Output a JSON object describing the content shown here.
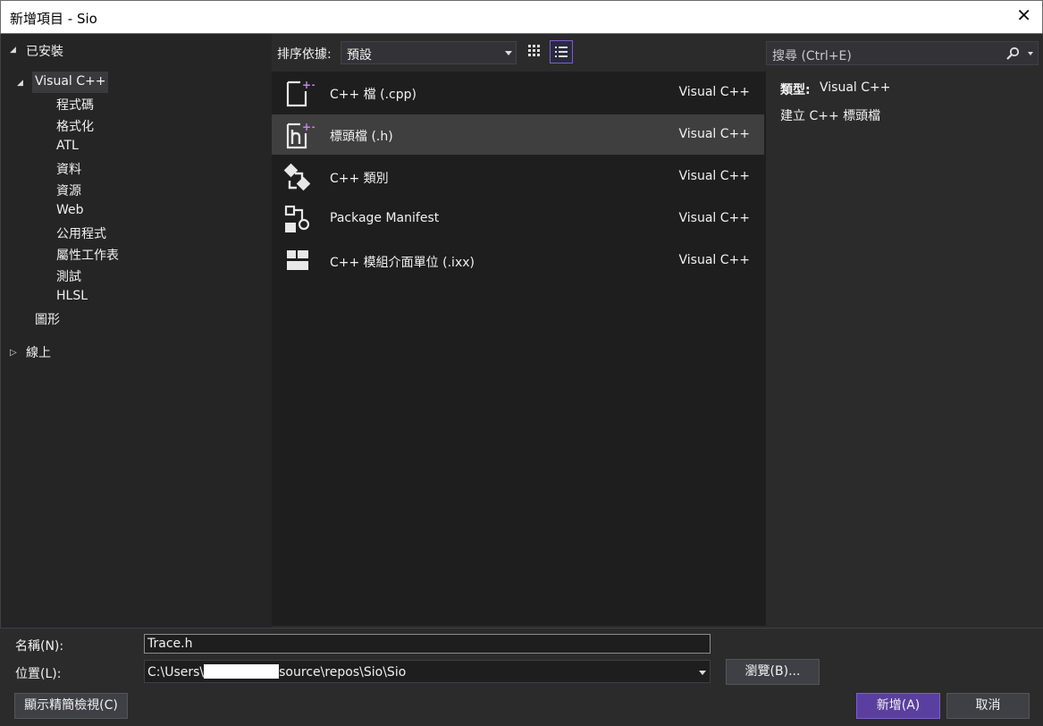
{
  "window": {
    "title": "新增項目 - Sio",
    "close_glyph": "✕"
  },
  "left_tree": {
    "installed_label": "已安裝",
    "visual_cpp_label": "Visual C++",
    "children": [
      "程式碼",
      "格式化",
      "ATL",
      "資料",
      "資源",
      "Web",
      "公用程式",
      "屬性工作表",
      "測試",
      "HLSL"
    ],
    "graphics_label": "圖形",
    "online_label": "線上"
  },
  "toolbar": {
    "sort_label": "排序依據:",
    "sort_value": "預設",
    "view_grid_icon": "grid-view-icon",
    "view_list_icon": "list-view-icon"
  },
  "search": {
    "placeholder": "搜尋 (Ctrl+E)",
    "icon": "search-icon"
  },
  "templates": [
    {
      "name": "C++ 檔 (.cpp)",
      "lang": "Visual C++",
      "icon": "cpp-file-icon",
      "selected": false
    },
    {
      "name": "標頭檔 (.h)",
      "lang": "Visual C++",
      "icon": "header-file-icon",
      "selected": true
    },
    {
      "name": "C++ 類別",
      "lang": "Visual C++",
      "icon": "cpp-class-icon",
      "selected": false
    },
    {
      "name": "Package Manifest",
      "lang": "Visual C++",
      "icon": "package-manifest-icon",
      "selected": false
    },
    {
      "name": "C++ 模組介面單位 (.ixx)",
      "lang": "Visual C++",
      "icon": "module-interface-icon",
      "selected": false
    }
  ],
  "details": {
    "type_label": "類型:",
    "type_value": "Visual C++",
    "description": "建立 C++ 標頭檔"
  },
  "bottom": {
    "name_label": "名稱(N):",
    "name_value": "Trace.h",
    "location_label": "位置(L):",
    "location_prefix": "C:\\Users\\",
    "location_suffix": "source\\repos\\Sio\\Sio",
    "browse_label": "瀏覽(B)...",
    "compact_view_label": "顯示精簡檢視(C)",
    "add_label": "新增(A)",
    "cancel_label": "取消"
  },
  "colors": {
    "accent": "#5b3fa0",
    "selection": "#3f3f40",
    "background": "#2b2b2b",
    "list_bg": "#1e1e1e"
  }
}
